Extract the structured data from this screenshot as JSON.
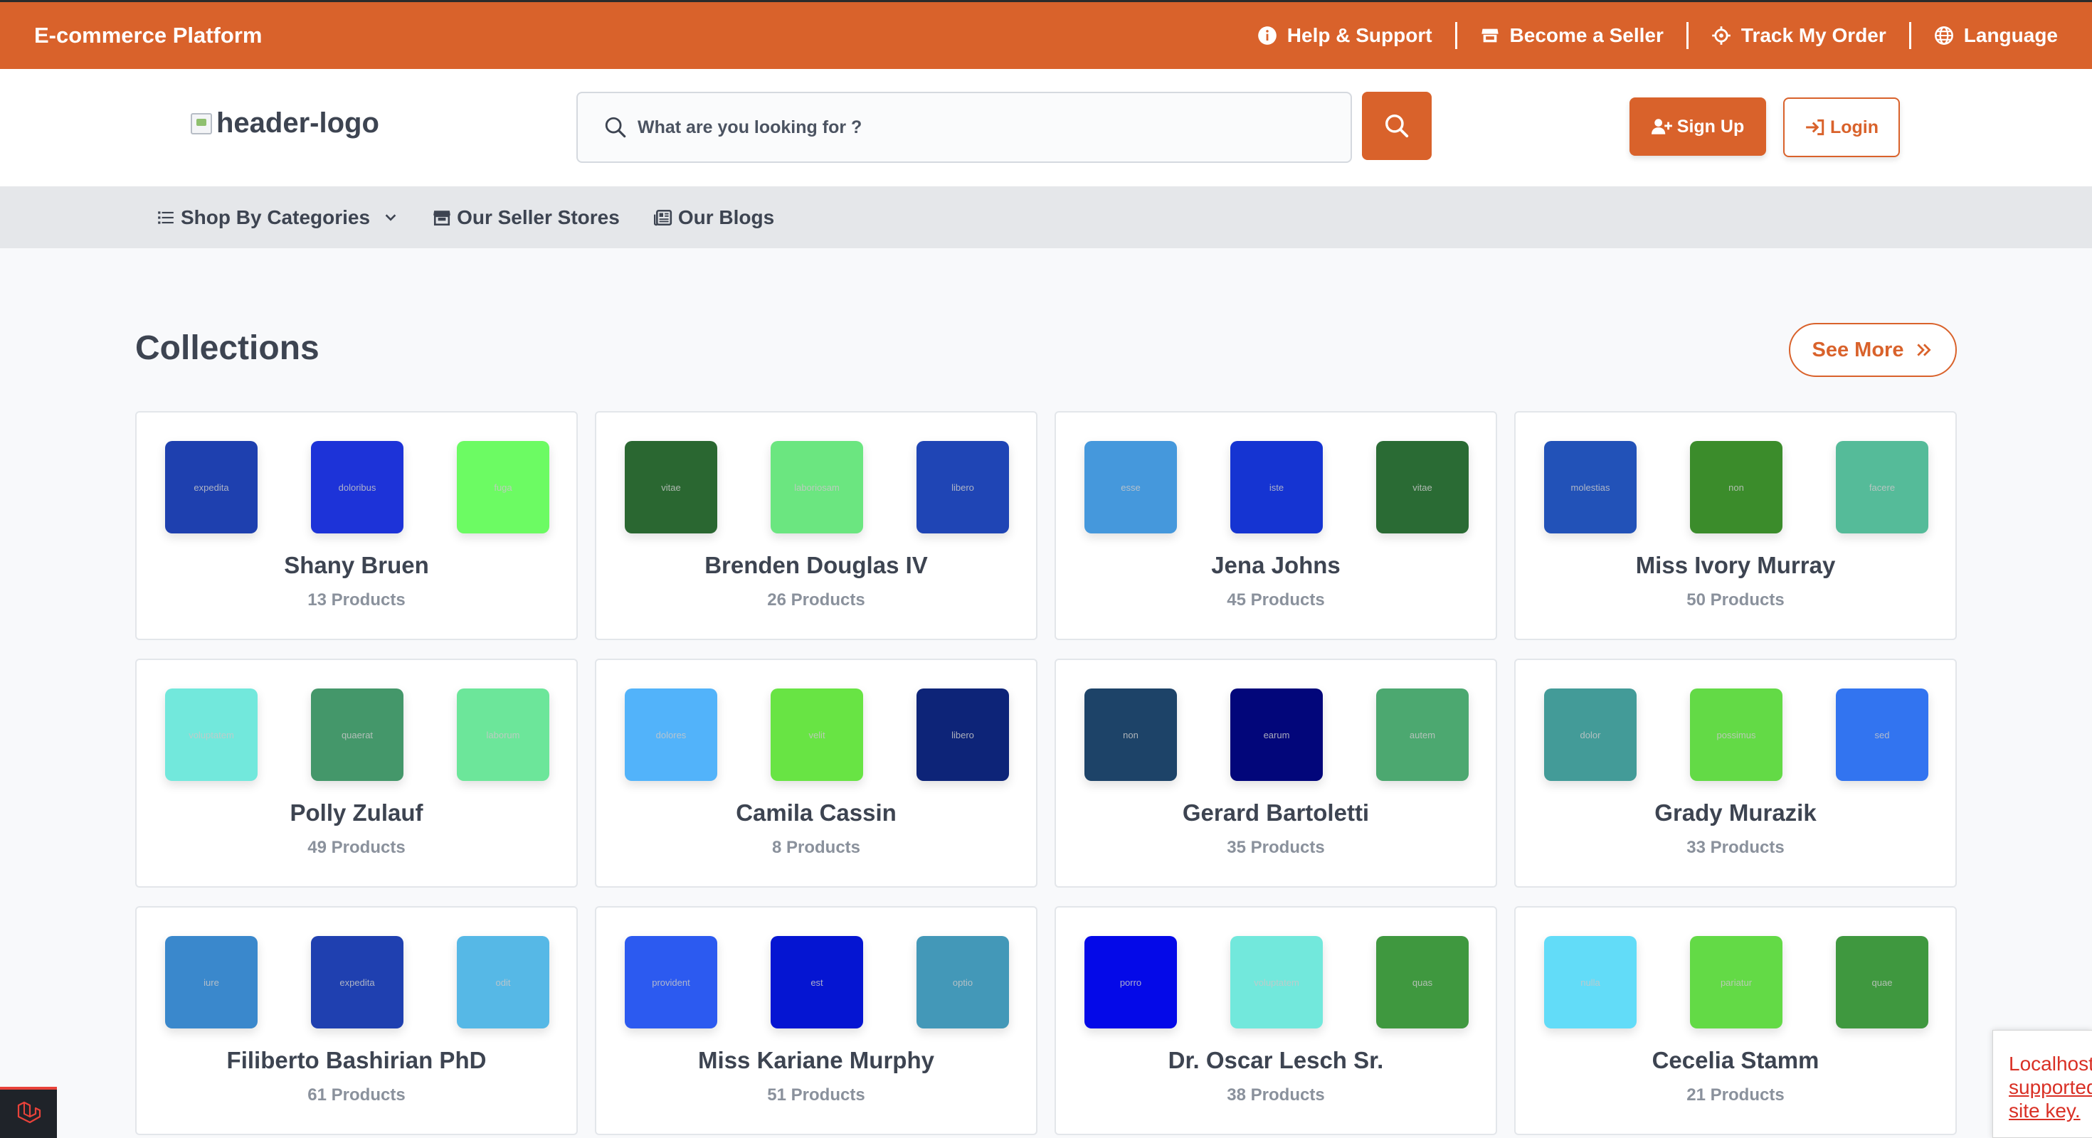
{
  "topbar": {
    "brand": "E-commerce Platform",
    "links": [
      {
        "label": "Help & Support",
        "icon": "info-icon"
      },
      {
        "label": "Become a Seller",
        "icon": "store-icon"
      },
      {
        "label": "Track My Order",
        "icon": "target-icon"
      },
      {
        "label": "Language",
        "icon": "globe-icon"
      }
    ]
  },
  "header": {
    "logo_alt": "header-logo",
    "search_placeholder": "What are you looking for ?",
    "signup_label": "Sign Up",
    "login_label": "Login"
  },
  "nav": {
    "categories": "Shop By Categories",
    "stores": "Our Seller Stores",
    "blogs": "Our Blogs"
  },
  "collections": {
    "title": "Collections",
    "see_more": "See More",
    "items": [
      {
        "name": "Shany Bruen",
        "count": "13 Products",
        "thumbs": [
          {
            "color": "#1e40af",
            "word": "expedita"
          },
          {
            "color": "#1d33d8",
            "word": "doloribus"
          },
          {
            "color": "#6cfb63",
            "word": "fuga"
          }
        ]
      },
      {
        "name": "Brenden Douglas IV",
        "count": "26 Products",
        "thumbs": [
          {
            "color": "#2a6731",
            "word": "vitae"
          },
          {
            "color": "#6be680",
            "word": "laboriosam"
          },
          {
            "color": "#1f45b5",
            "word": "libero"
          }
        ]
      },
      {
        "name": "Jena Johns",
        "count": "45 Products",
        "thumbs": [
          {
            "color": "#4598dc",
            "word": "esse"
          },
          {
            "color": "#1534d2",
            "word": "iste"
          },
          {
            "color": "#2a6b34",
            "word": "vitae"
          }
        ]
      },
      {
        "name": "Miss Ivory Murray",
        "count": "50 Products",
        "thumbs": [
          {
            "color": "#2252b8",
            "word": "molestias"
          },
          {
            "color": "#3b8c2b",
            "word": "non"
          },
          {
            "color": "#55bb99",
            "word": "facere"
          }
        ]
      },
      {
        "name": "Polly Zulauf",
        "count": "49 Products",
        "thumbs": [
          {
            "color": "#72e8dc",
            "word": "voluptatem"
          },
          {
            "color": "#44976a",
            "word": "quaerat"
          },
          {
            "color": "#6ce69a",
            "word": "laborum"
          }
        ]
      },
      {
        "name": "Camila Cassin",
        "count": "8 Products",
        "thumbs": [
          {
            "color": "#52b3fa",
            "word": "dolores"
          },
          {
            "color": "#68e444",
            "word": "velit"
          },
          {
            "color": "#0d2478",
            "word": "libero"
          }
        ]
      },
      {
        "name": "Gerard Bartoletti",
        "count": "35 Products",
        "thumbs": [
          {
            "color": "#1d4368",
            "word": "non"
          },
          {
            "color": "#02067a",
            "word": "earum"
          },
          {
            "color": "#4ca870",
            "word": "autem"
          }
        ]
      },
      {
        "name": "Grady Murazik",
        "count": "33 Products",
        "thumbs": [
          {
            "color": "#439b98",
            "word": "dolor"
          },
          {
            "color": "#63da46",
            "word": "possimus"
          },
          {
            "color": "#3274f0",
            "word": "sed"
          }
        ]
      },
      {
        "name": "Filiberto Bashirian PhD",
        "count": "61 Products",
        "thumbs": [
          {
            "color": "#3a88cc",
            "word": "iure"
          },
          {
            "color": "#1f40b0",
            "word": "expedita"
          },
          {
            "color": "#56b8e6",
            "word": "odit"
          }
        ]
      },
      {
        "name": "Miss Kariane Murphy",
        "count": "51 Products",
        "thumbs": [
          {
            "color": "#2c5af0",
            "word": "provident"
          },
          {
            "color": "#0515d2",
            "word": "est"
          },
          {
            "color": "#4398b8",
            "word": "optio"
          }
        ]
      },
      {
        "name": "Dr. Oscar Lesch Sr.",
        "count": "38 Products",
        "thumbs": [
          {
            "color": "#0409e8",
            "word": "porro"
          },
          {
            "color": "#72e8dc",
            "word": "voluptatem"
          },
          {
            "color": "#3f983f",
            "word": "quas"
          }
        ]
      },
      {
        "name": "Cecelia Stamm",
        "count": "21 Products",
        "thumbs": [
          {
            "color": "#62dcf8",
            "word": "nulla"
          },
          {
            "color": "#63da46",
            "word": "pariatur"
          },
          {
            "color": "#3f983f",
            "word": "quae"
          }
        ]
      }
    ]
  },
  "recaptcha": {
    "line1": "Localhost",
    "line2": "supported",
    "line3": "site key."
  }
}
